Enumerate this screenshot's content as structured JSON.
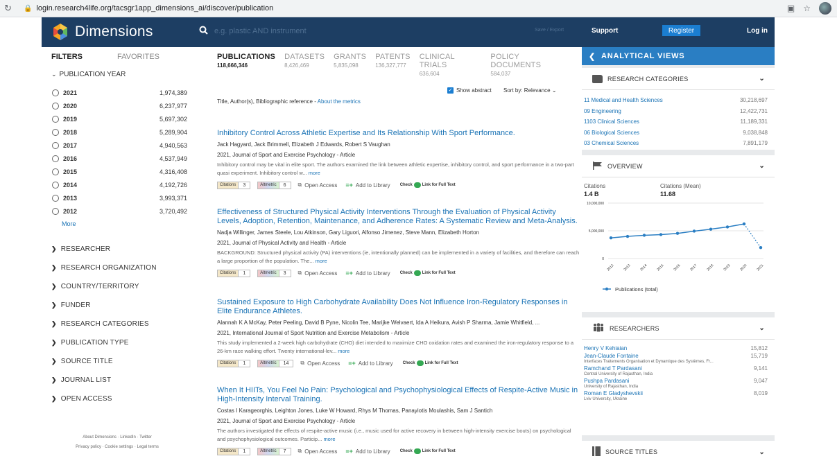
{
  "browser": {
    "url": "login.research4life.org/tacsgr1app_dimensions_ai/discover/publication"
  },
  "header": {
    "brand": "Dimensions",
    "search_placeholder": "e.g. plastic AND instrument",
    "save_export": "Save / Export",
    "support": "Support",
    "register": "Register",
    "login": "Log in"
  },
  "filters": {
    "tab_filters": "FILTERS",
    "tab_favorites": "FAVORITES",
    "pub_year_title": "PUBLICATION YEAR",
    "years": [
      {
        "year": "2021",
        "count": "1,974,389"
      },
      {
        "year": "2020",
        "count": "6,237,977"
      },
      {
        "year": "2019",
        "count": "5,697,302"
      },
      {
        "year": "2018",
        "count": "5,289,904"
      },
      {
        "year": "2017",
        "count": "4,940,563"
      },
      {
        "year": "2016",
        "count": "4,537,949"
      },
      {
        "year": "2015",
        "count": "4,316,408"
      },
      {
        "year": "2014",
        "count": "4,192,726"
      },
      {
        "year": "2013",
        "count": "3,993,371"
      },
      {
        "year": "2012",
        "count": "3,720,492"
      }
    ],
    "more": "More",
    "sections": [
      "RESEARCHER",
      "RESEARCH ORGANIZATION",
      "COUNTRY/TERRITORY",
      "FUNDER",
      "RESEARCH CATEGORIES",
      "PUBLICATION TYPE",
      "SOURCE TITLE",
      "JOURNAL LIST",
      "OPEN ACCESS"
    ],
    "footer_line1": "About Dimensions · LinkedIn · Twitter",
    "footer_line2": "Privacy policy · Cookie settings · Legal terms"
  },
  "content_tabs": [
    {
      "label": "PUBLICATIONS",
      "count": "118,666,346"
    },
    {
      "label": "DATASETS",
      "count": "8,426,469"
    },
    {
      "label": "GRANTS",
      "count": "5,835,098"
    },
    {
      "label": "PATENTS",
      "count": "136,327,777"
    },
    {
      "label": "CLINICAL TRIALS",
      "count": "636,604"
    },
    {
      "label": "POLICY DOCUMENTS",
      "count": "584,037"
    }
  ],
  "results_options": {
    "show_abstract": "Show abstract",
    "sort": "Sort by: Relevance",
    "metrics_prefix": "Title, Author(s), Bibliographic reference - ",
    "metrics_link": "About the metrics"
  },
  "badge_labels": {
    "citations": "Citations",
    "altmetric": "Altmetric",
    "open_access": "Open Access",
    "add_library": "Add to Library",
    "check": "Check",
    "full_text": "Link for Full Text",
    "more": "more"
  },
  "results": [
    {
      "title": "Inhibitory Control Across Athletic Expertise and Its Relationship With Sport Performance.",
      "authors": "Jack Hagyard, Jack Brimmell, Elizabeth J Edwards, Robert S Vaughan",
      "journal": "2021, Journal of Sport and Exercise Psychology - Article",
      "abstract": "Inhibitory control may be vital in elite sport. The authors examined the link between athletic expertise, inhibitory control, and sport performance in a two-part quasi experiment. Inhibitory control w...",
      "citations": "3",
      "altmetric": "6"
    },
    {
      "title": "Effectiveness of Structured Physical Activity Interventions Through the Evaluation of Physical Activity Levels, Adoption, Retention, Maintenance, and Adherence Rates: A Systematic Review and Meta-Analysis.",
      "authors": "Nadja Willinger, James Steele, Lou Atkinson, Gary Liguori, Alfonso Jimenez, Steve Mann, Elizabeth Horton",
      "journal": "2021, Journal of Physical Activity and Health - Article",
      "abstract": "BACKGROUND: Structured physical activity (PA) interventions (ie, intentionally planned) can be implemented in a variety of facilities, and therefore can reach a large proportion of the population. The...",
      "citations": "1",
      "altmetric": "3"
    },
    {
      "title": "Sustained Exposure to High Carbohydrate Availability Does Not Influence Iron-Regulatory Responses in Elite Endurance Athletes.",
      "authors": "Alannah K A McKay, Peter Peeling, David B Pyne, Nicolin Tee, Marijke Welvaert, Ida A Heikura, Avish P Sharma, Jamie Whitfield, ...",
      "journal": "2021, International Journal of Sport Nutrition and Exercise Metabolism - Article",
      "abstract": "This study implemented a 2-week high carbohydrate (CHO) diet intended to maximize CHO oxidation rates and examined the iron-regulatory response to a 26-km race walking effort. Twenty international-lev...",
      "citations": "1",
      "altmetric": "14"
    },
    {
      "title": "When It HIITs, You Feel No Pain: Psychological and Psychophysiological Effects of Respite-Active Music in High-Intensity Interval Training.",
      "authors": "Costas I Karageorghis, Leighton Jones, Luke W Howard, Rhys M Thomas, Panayiotis Moulashis, Sam J Santich",
      "journal": "2021, Journal of Sport and Exercise Psychology - Article",
      "abstract": "The authors investigated the effects of respite-active music (i.e., music used for active recovery in between high-intensity exercise bouts) on psychological and psychophysiological outcomes. Particip...",
      "citations": "1",
      "altmetric": "7"
    }
  ],
  "analytical_views": {
    "title": "ANALYTICAL VIEWS",
    "research_categories": {
      "title": "RESEARCH CATEGORIES",
      "rows": [
        {
          "label": "11 Medical and Health Sciences",
          "count": "30,218,697"
        },
        {
          "label": "09 Engineering",
          "count": "12,422,731"
        },
        {
          "label": "1103 Clinical Sciences",
          "count": "11,189,331"
        },
        {
          "label": "06 Biological Sciences",
          "count": "9,038,848"
        },
        {
          "label": "03 Chemical Sciences",
          "count": "7,891,179"
        }
      ]
    },
    "overview": {
      "title": "OVERVIEW",
      "citations_label": "Citations",
      "citations_value": "1.4 B",
      "mean_label": "Citations (Mean)",
      "mean_value": "11.68"
    },
    "researchers": {
      "title": "RESEARCHERS",
      "rows": [
        {
          "name": "Henry V Kehiaian",
          "count": "15,812",
          "affiliation": ""
        },
        {
          "name": "Jean-Claude Fontaine",
          "count": "15,719",
          "affiliation": "Interfaces Traitements Organisation et Dynamique des Systèmes, Fr..."
        },
        {
          "name": "Ramchand T Pardasani",
          "count": "9,141",
          "affiliation": "Central University of Rajasthan, India"
        },
        {
          "name": "Pushpa Pardasani",
          "count": "9,047",
          "affiliation": "University of Rajasthan, India"
        },
        {
          "name": "Roman E Gladyshevskii",
          "count": "8,019",
          "affiliation": "Lviv University, Ukraine"
        }
      ]
    },
    "source_titles": {
      "title": "SOURCE TITLES"
    }
  },
  "chart_data": {
    "type": "line",
    "x": [
      "2012",
      "2013",
      "2014",
      "2015",
      "2016",
      "2017",
      "2018",
      "2019",
      "2020",
      "2021"
    ],
    "series": [
      {
        "name": "Publications (total)",
        "values": [
          3720492,
          3993371,
          4192726,
          4316408,
          4537949,
          4940563,
          5289904,
          5697302,
          6237977,
          1974389
        ]
      }
    ],
    "yticks": [
      "0",
      "5,000,000",
      "10,000,000"
    ],
    "ylim": [
      0,
      10000000
    ],
    "last_segment_dashed": true,
    "legend_position": "bottom-left",
    "color": "#2a7ec3"
  }
}
